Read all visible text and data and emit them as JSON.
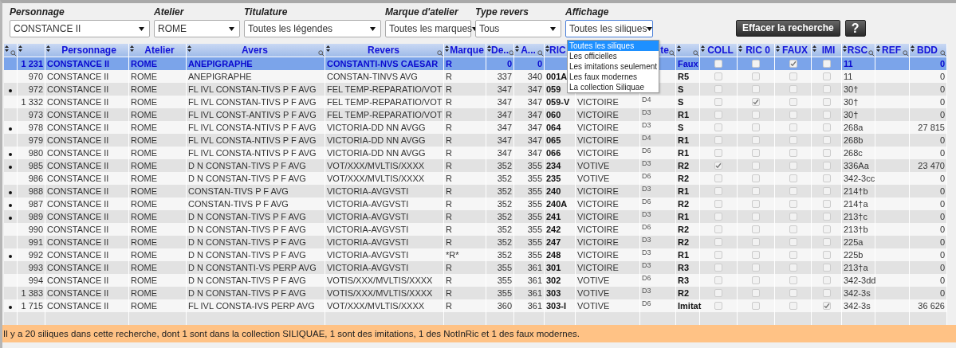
{
  "filters": [
    {
      "label": "Personnage",
      "value": "CONSTANCE II"
    },
    {
      "label": "Atelier",
      "value": "ROME"
    },
    {
      "label": "Titulature",
      "value": "Toutes les légendes"
    },
    {
      "label": "Marque d'atelier",
      "value": "Toutes les marques"
    },
    {
      "label": "Type revers",
      "value": "Tous"
    },
    {
      "label": "Affichage",
      "value": "Toutes les siliques",
      "expanded": true
    }
  ],
  "display_menu": {
    "options": [
      {
        "label": "Toutes les siliques",
        "selected": true
      },
      {
        "label": "Les officielles",
        "selected": false
      },
      {
        "label": "Les imitations seulement",
        "selected": false
      },
      {
        "label": "Les faux modernes",
        "selected": false
      },
      {
        "label": "La collection Siliquae",
        "selected": false
      }
    ]
  },
  "buttons": [
    {
      "label": "Effacer la recherche"
    },
    {
      "label": "?"
    }
  ],
  "table": {
    "columns": [
      {
        "sortable": true,
        "search": true
      },
      {
        "sortable": true,
        "search": false
      },
      {
        "label": "Personnage",
        "sortable": true,
        "search": false
      },
      {
        "label": "Atelier",
        "sortable": true,
        "search": false
      },
      {
        "label": "Avers",
        "sortable": true,
        "search": true
      },
      {
        "label": "Revers",
        "sortable": true,
        "search": true
      },
      {
        "label": "Marque",
        "sortable": true,
        "search": false
      },
      {
        "label": "De..",
        "sortable": true,
        "search": true
      },
      {
        "label": "A...",
        "sortable": true,
        "search": true
      },
      {
        "label": "RIC",
        "sortable": true,
        "search": false
      },
      {},
      {
        "label": "te",
        "sortable": false,
        "search": true
      },
      {
        "sortable": true,
        "search": true
      },
      {
        "label": "COLL",
        "sortable": true,
        "search": false
      },
      {
        "label": "RIC 0",
        "sortable": true,
        "search": false
      },
      {
        "label": "FAUX",
        "sortable": true,
        "search": false
      },
      {
        "label": "IMI",
        "sortable": true,
        "search": false
      },
      {
        "label": "RSC",
        "sortable": true,
        "search": true
      },
      {
        "label": "REF",
        "sortable": true,
        "search": true
      },
      {
        "label": "BDD",
        "sortable": true,
        "search": true
      }
    ],
    "rows": [
      {
        "kind": "summary",
        "marked": false,
        "number": "1 231",
        "personnage": "CONSTANCE II",
        "atelier": "ROME",
        "avers": "ANEPIGRAPHE",
        "revers": "CONSTANTI-NVS CAESAR",
        "marque": "R",
        "de": "0",
        "a": "0",
        "r": "Faux",
        "coll": false,
        "ric0": false,
        "faux": true,
        "imi": false,
        "rsc": "11",
        "bdd": "0"
      },
      {
        "kind": "item",
        "marked": false,
        "number": "970",
        "personnage": "CONSTANCE II",
        "atelier": "ROME",
        "avers": "ANEPIGRAPHE",
        "revers": "CONSTAN-TINVS AVG",
        "marque": "R",
        "de": "337",
        "a": "340",
        "ric": "001A",
        "r": "R5",
        "coll": false,
        "ric0": false,
        "faux": false,
        "imi": false,
        "rsc": "11",
        "bdd": "0"
      },
      {
        "kind": "item",
        "marked": true,
        "number": "972",
        "personnage": "CONSTANCE II",
        "atelier": "ROME",
        "avers": "FL IVL CONSTAN-TIVS P F AVG",
        "revers": "FEL TEMP-REPARATIO/VOT",
        "marque": "R",
        "de": "347",
        "a": "347",
        "ric": "059",
        "r": "S",
        "coll": false,
        "ric0": false,
        "faux": false,
        "imi": false,
        "rsc": "30†",
        "bdd": "0"
      },
      {
        "kind": "item",
        "marked": false,
        "number": "1 332",
        "personnage": "CONSTANCE II",
        "atelier": "ROME",
        "avers": "FL IVL CONSTAN-TIVS P F AVG",
        "revers": "FEL TEMP-REPARATIO/VOT",
        "marque": "R",
        "de": "347",
        "a": "347",
        "ric": "059-V",
        "type": "VICTOIRE",
        "d": "D4",
        "r": "S",
        "coll": false,
        "ric0": true,
        "faux": false,
        "imi": false,
        "rsc": "30†",
        "bdd": "0"
      },
      {
        "kind": "item",
        "marked": false,
        "number": "973",
        "personnage": "CONSTANCE II",
        "atelier": "ROME",
        "avers": "FL IVL CONST-ANTIVS P F AVG",
        "revers": "FEL TEMP-REPARATIO/VOT",
        "marque": "R",
        "de": "347",
        "a": "347",
        "ric": "060",
        "type": "VICTOIRE",
        "d": "D3",
        "r": "R1",
        "coll": false,
        "ric0": false,
        "faux": false,
        "imi": false,
        "rsc": "30†",
        "bdd": "0"
      },
      {
        "kind": "item",
        "marked": true,
        "number": "978",
        "personnage": "CONSTANCE II",
        "atelier": "ROME",
        "avers": "FL IVL CONSTA-NTIVS P F AVG",
        "revers": "VICTORIA-DD NN AVGG",
        "marque": "R",
        "de": "347",
        "a": "347",
        "ric": "064",
        "type": "VICTOIRE",
        "d": "D3",
        "r": "S",
        "coll": false,
        "ric0": false,
        "faux": false,
        "imi": false,
        "rsc": "268a",
        "bdd": "27 815"
      },
      {
        "kind": "item",
        "marked": false,
        "number": "979",
        "personnage": "CONSTANCE II",
        "atelier": "ROME",
        "avers": "FL IVL CONSTA-NTIVS P F AVG",
        "revers": "VICTORIA-DD NN AVGG",
        "marque": "R",
        "de": "347",
        "a": "347",
        "ric": "065",
        "type": "VICTOIRE",
        "d": "D4",
        "r": "R1",
        "coll": false,
        "ric0": false,
        "faux": false,
        "imi": false,
        "rsc": "268b",
        "bdd": "0"
      },
      {
        "kind": "item",
        "marked": true,
        "number": "980",
        "personnage": "CONSTANCE II",
        "atelier": "ROME",
        "avers": "FL IVL CONSTA-NTIVS P F AVG",
        "revers": "VICTORIA-DD NN AVGG",
        "marque": "R",
        "de": "347",
        "a": "347",
        "ric": "066",
        "type": "VICTOIRE",
        "d": "D6",
        "r": "R1",
        "coll": false,
        "ric0": false,
        "faux": false,
        "imi": false,
        "rsc": "268c",
        "bdd": "0"
      },
      {
        "kind": "item",
        "marked": true,
        "number": "985",
        "personnage": "CONSTANCE II",
        "atelier": "ROME",
        "avers": "D N CONSTAN-TIVS P F AVG",
        "revers": "VOT/XXX/MVLTIS/XXXX",
        "marque": "R",
        "de": "352",
        "a": "355",
        "ric": "234",
        "type": "VOTIVE",
        "d": "D3",
        "r": "R2",
        "coll": true,
        "ric0": false,
        "faux": false,
        "imi": false,
        "rsc": "336Aa",
        "bdd": "23 470"
      },
      {
        "kind": "item",
        "marked": false,
        "number": "986",
        "personnage": "CONSTANCE II",
        "atelier": "ROME",
        "avers": "D N CONSTAN-TIVS P F AVG",
        "revers": "VOT/XXX/MVLTIS/XXXX",
        "marque": "R",
        "de": "352",
        "a": "355",
        "ric": "235",
        "type": "VOTIVE",
        "d": "D6",
        "r": "R2",
        "coll": false,
        "ric0": false,
        "faux": false,
        "imi": false,
        "rsc": "342-3cc",
        "bdd": "0"
      },
      {
        "kind": "item",
        "marked": true,
        "number": "988",
        "personnage": "CONSTANCE II",
        "atelier": "ROME",
        "avers": "CONSTAN-TIVS P F AVG",
        "revers": "VICTORIA-AVGVSTI",
        "marque": "R",
        "de": "352",
        "a": "355",
        "ric": "240",
        "type": "VICTOIRE",
        "d": "D3",
        "r": "R1",
        "coll": false,
        "ric0": false,
        "faux": false,
        "imi": false,
        "rsc": "214†b",
        "bdd": "0"
      },
      {
        "kind": "item",
        "marked": true,
        "number": "987",
        "personnage": "CONSTANCE II",
        "atelier": "ROME",
        "avers": "CONSTAN-TIVS P F AVG",
        "revers": "VICTORIA-AVGVSTI",
        "marque": "R",
        "de": "352",
        "a": "355",
        "ric": "240A",
        "type": "VICTOIRE",
        "d": "D6",
        "r": "R2",
        "coll": false,
        "ric0": false,
        "faux": false,
        "imi": false,
        "rsc": "214†a",
        "bdd": "0"
      },
      {
        "kind": "item",
        "marked": true,
        "number": "989",
        "personnage": "CONSTANCE II",
        "atelier": "ROME",
        "avers": "D N CONSTAN-TIVS P F AVG",
        "revers": "VICTORIA-AVGVSTI",
        "marque": "R",
        "de": "352",
        "a": "355",
        "ric": "241",
        "type": "VICTOIRE",
        "d": "D3",
        "r": "R1",
        "coll": false,
        "ric0": false,
        "faux": false,
        "imi": false,
        "rsc": "213†c",
        "bdd": "0"
      },
      {
        "kind": "item",
        "marked": false,
        "number": "990",
        "personnage": "CONSTANCE II",
        "atelier": "ROME",
        "avers": "D N CONSTAN-TIVS P F AVG",
        "revers": "VICTORIA-AVGVSTI",
        "marque": "R",
        "de": "352",
        "a": "355",
        "ric": "242",
        "type": "VICTOIRE",
        "d": "D6",
        "r": "R2",
        "coll": false,
        "ric0": false,
        "faux": false,
        "imi": false,
        "rsc": "213†b",
        "bdd": "0"
      },
      {
        "kind": "item",
        "marked": false,
        "number": "991",
        "personnage": "CONSTANCE II",
        "atelier": "ROME",
        "avers": "D N CONSTAN-TIVS P F AVG",
        "revers": "VICTORIA-AVGVSTI",
        "marque": "R",
        "de": "352",
        "a": "355",
        "ric": "247",
        "type": "VICTOIRE",
        "d": "D3",
        "r": "R2",
        "coll": false,
        "ric0": false,
        "faux": false,
        "imi": false,
        "rsc": "225a",
        "bdd": "0"
      },
      {
        "kind": "item",
        "marked": true,
        "number": "992",
        "personnage": "CONSTANCE II",
        "atelier": "ROME",
        "avers": "D N CONSTAN-TIVS P F AVG",
        "revers": "VICTORIA-AVGVSTI",
        "marque": "*R*",
        "de": "352",
        "a": "355",
        "ric": "248",
        "type": "VICTOIRE",
        "d": "D3",
        "r": "R1",
        "coll": false,
        "ric0": false,
        "faux": false,
        "imi": false,
        "rsc": "225b",
        "bdd": "0"
      },
      {
        "kind": "item",
        "marked": false,
        "number": "993",
        "personnage": "CONSTANCE II",
        "atelier": "ROME",
        "avers": "D N CONSTANTI-VS PERP AVG",
        "revers": "VICTORIA-AVGVSTI",
        "marque": "R",
        "de": "355",
        "a": "361",
        "ric": "301",
        "type": "VICTOIRE",
        "d": "D3",
        "r": "R3",
        "coll": false,
        "ric0": false,
        "faux": false,
        "imi": false,
        "rsc": "213†a",
        "bdd": "0"
      },
      {
        "kind": "item",
        "marked": false,
        "number": "994",
        "personnage": "CONSTANCE II",
        "atelier": "ROME",
        "avers": "D N CONSTAN-TIVS P F AVG",
        "revers": "VOTIS/XXX/MVLTIS/XXXX",
        "marque": "R",
        "de": "355",
        "a": "361",
        "ric": "302",
        "type": "VOTIVE",
        "d": "D6",
        "r": "R3",
        "coll": false,
        "ric0": false,
        "faux": false,
        "imi": false,
        "rsc": "342-3dd",
        "bdd": "0"
      },
      {
        "kind": "item",
        "marked": false,
        "number": "1 383",
        "personnage": "CONSTANCE II",
        "atelier": "ROME",
        "avers": "D N CONSTAN-TIVS P F AVG",
        "revers": "VOTIS/XXX/MVLTIS/XXXX",
        "marque": "R",
        "de": "355",
        "a": "361",
        "ric": "303",
        "type": "VOTIVE",
        "d": "D3",
        "r": "R2",
        "coll": false,
        "ric0": false,
        "faux": false,
        "imi": false,
        "rsc": "342-3s",
        "bdd": "0"
      },
      {
        "kind": "item",
        "marked": true,
        "number": "1 715",
        "personnage": "CONSTANCE II",
        "atelier": "ROME",
        "avers": "FL IVL CONSTA-IVS PERP AVG",
        "revers": "VOT/XXX/MVLTIS/XXXX",
        "marque": "R",
        "de": "360",
        "a": "361",
        "ric": "303-I",
        "type": "VOTIVE",
        "d": "D6",
        "r": "Imitat",
        "coll": false,
        "ric0": false,
        "faux": false,
        "imi": true,
        "rsc": "342-3s",
        "bdd": "36 626"
      }
    ]
  },
  "status_bar": "Il y a 20 siliques dans cette recherche, dont 1 sont dans la collection SILIQUAE, 1 sont des imitations, 1 des NotInRic et 1 des faux modernes."
}
